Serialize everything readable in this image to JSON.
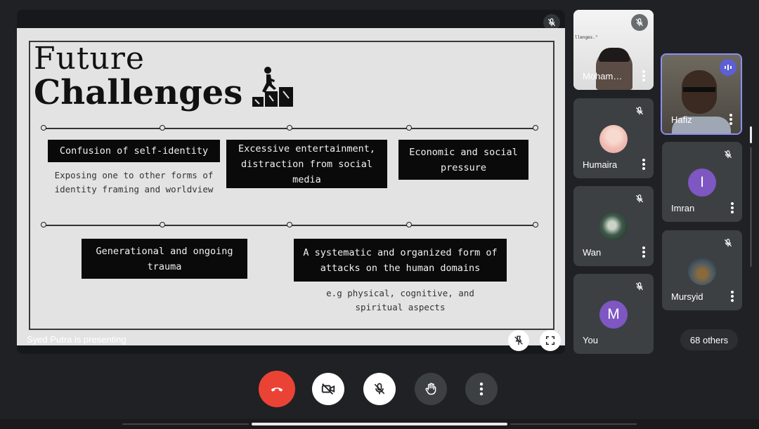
{
  "slide": {
    "title_line1": "Future",
    "title_line2": "Challenges",
    "boxes": [
      {
        "text": "Confusion of self-identity"
      },
      {
        "text": "Excessive entertainment, distraction from social media"
      },
      {
        "text": "Economic and social pressure"
      },
      {
        "text": "Generational and ongoing trauma"
      },
      {
        "text": "A systematic and organized form of attacks on the human domains"
      }
    ],
    "descriptions": [
      "Exposing one to other forms of identity framing and worldview",
      "e.g physical, cognitive, and spiritual aspects"
    ]
  },
  "presentation": {
    "presenter_label": "Syed Putra is presenting",
    "pin_icon": "unpin-icon",
    "fullscreen_icon": "fullscreen-icon"
  },
  "participants": [
    {
      "name": "Moham…",
      "muted": true,
      "kind": "video"
    },
    {
      "name": "Hafiz",
      "muted": false,
      "speaking": true,
      "kind": "video"
    },
    {
      "name": "Humaira",
      "muted": true,
      "kind": "photo"
    },
    {
      "name": "Imran",
      "muted": true,
      "kind": "letter",
      "letter": "I"
    },
    {
      "name": "Wan",
      "muted": true,
      "kind": "photo"
    },
    {
      "name": "Mursyid",
      "muted": true,
      "kind": "photo"
    },
    {
      "name": "You",
      "muted": true,
      "kind": "letter",
      "letter": "M"
    }
  ],
  "others_count_label": "68 others",
  "controls": {
    "items": [
      "end-call-icon",
      "camera-off-icon",
      "mic-off-icon",
      "raise-hand-icon",
      "more-options-icon"
    ]
  },
  "colors": {
    "background": "#202124",
    "tile": "#3c4043",
    "end_call": "#ea4335",
    "speaking_accent": "#8c8ef5",
    "avatar_purple": "#7e57c2"
  }
}
